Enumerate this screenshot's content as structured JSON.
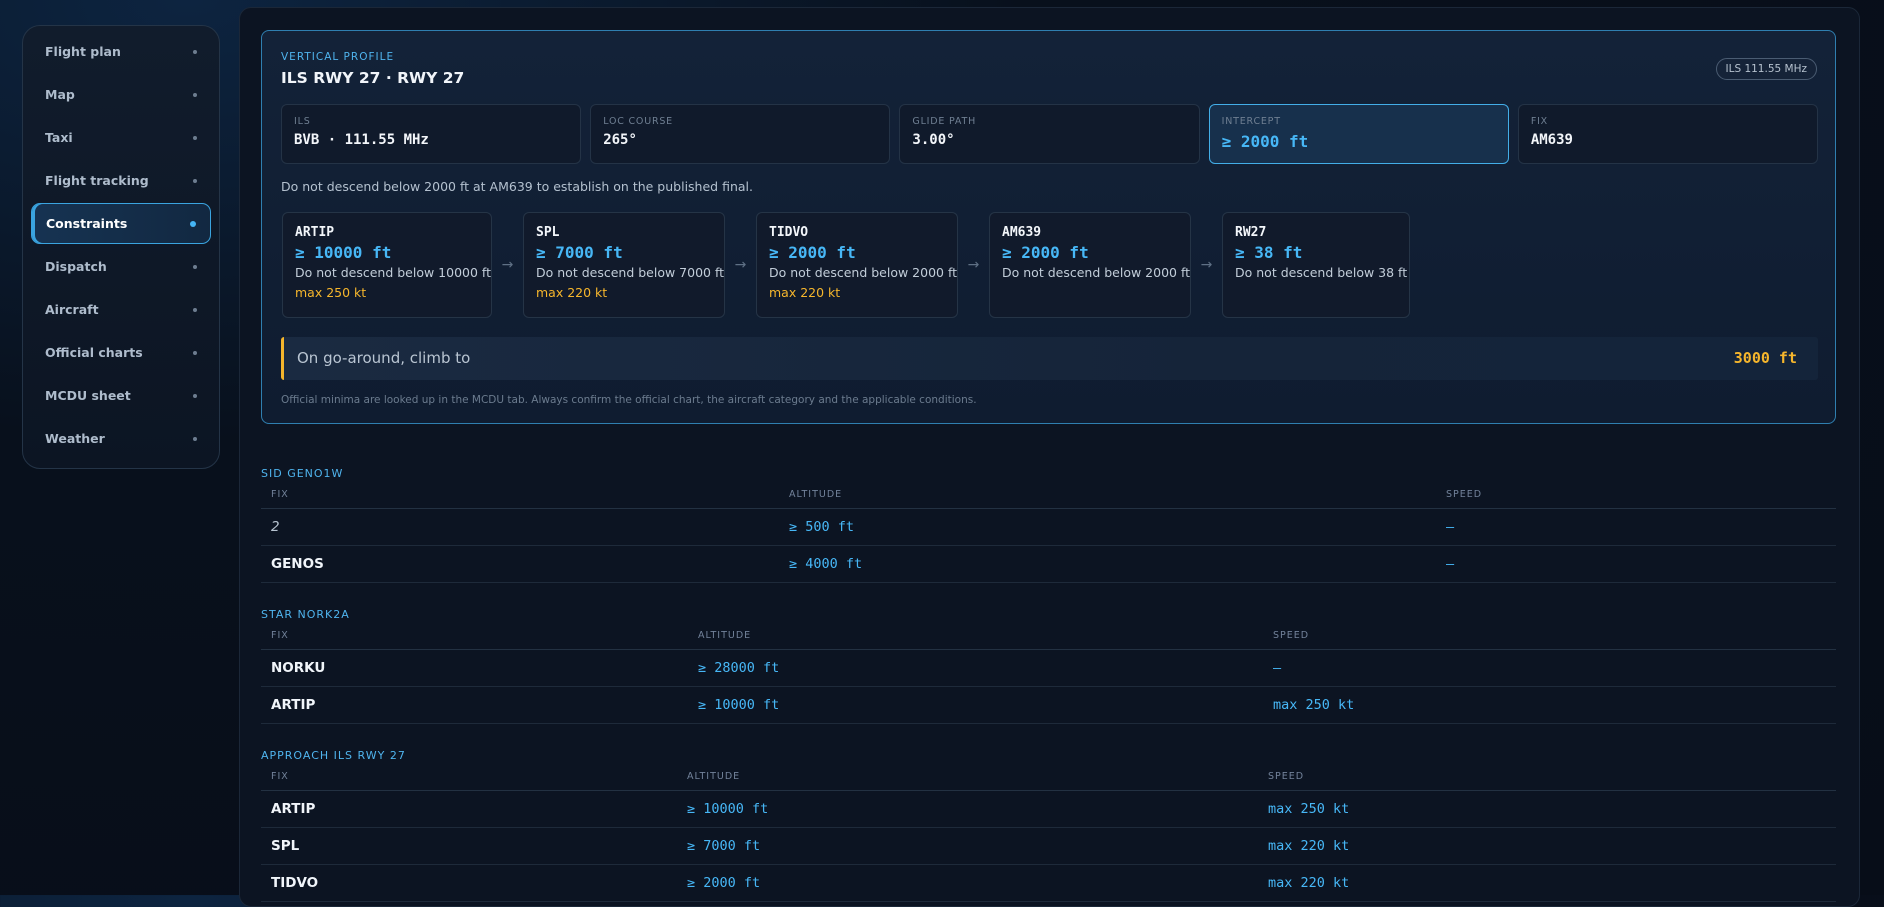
{
  "sidebar": {
    "items": [
      {
        "label": "Flight plan"
      },
      {
        "label": "Map"
      },
      {
        "label": "Taxi"
      },
      {
        "label": "Flight tracking"
      },
      {
        "label": "Constraints"
      },
      {
        "label": "Dispatch"
      },
      {
        "label": "Aircraft"
      },
      {
        "label": "Official charts"
      },
      {
        "label": "MCDU sheet"
      },
      {
        "label": "Weather"
      }
    ],
    "active": "Constraints"
  },
  "vertical_profile": {
    "kicker": "VERTICAL PROFILE",
    "title": "ILS RWY 27 · RWY 27",
    "badge": "ILS 111.55 MHz",
    "info": [
      {
        "label": "ILS",
        "value": "BVB · 111.55 MHz"
      },
      {
        "label": "LOC COURSE",
        "value": "265°"
      },
      {
        "label": "GLIDE PATH",
        "value": "3.00°"
      },
      {
        "label": "INTERCEPT",
        "value": "≥ 2000 ft"
      },
      {
        "label": "FIX",
        "value": "AM639"
      }
    ],
    "note": "Do not descend below 2000 ft at AM639 to establish on the published final.",
    "fixes": [
      {
        "name": "ARTIP",
        "alt": "≥ 10000 ft",
        "desc": "Do not descend below 10000 ft",
        "speed": "max 250 kt"
      },
      {
        "name": "SPL",
        "alt": "≥ 7000 ft",
        "desc": "Do not descend below 7000 ft",
        "speed": "max 220 kt"
      },
      {
        "name": "TIDVO",
        "alt": "≥ 2000 ft",
        "desc": "Do not descend below 2000 ft",
        "speed": "max 220 kt"
      },
      {
        "name": "AM639",
        "alt": "≥ 2000 ft",
        "desc": "Do not descend below 2000 ft",
        "speed": ""
      },
      {
        "name": "RW27",
        "alt": "≥ 38 ft",
        "desc": "Do not descend below 38 ft",
        "speed": ""
      }
    ],
    "arrow": "→",
    "go_around": {
      "label": "On go-around, climb to",
      "value": "3000 ft"
    },
    "footnote": "Official minima are looked up in the MCDU tab. Always confirm the official chart, the aircraft category and the applicable conditions."
  },
  "tables": [
    {
      "title": "SID GENO1W",
      "headers": [
        "FIX",
        "ALTITUDE",
        "SPEED"
      ],
      "rows": [
        [
          "2",
          "≥ 500 ft",
          "—"
        ],
        [
          "GENOS",
          "≥ 4000 ft",
          "—"
        ]
      ]
    },
    {
      "title": "STAR NORK2A",
      "headers": [
        "FIX",
        "ALTITUDE",
        "SPEED"
      ],
      "rows": [
        [
          "NORKU",
          "≥ 28000 ft",
          "—"
        ],
        [
          "ARTIP",
          "≥ 10000 ft",
          "max 250 kt"
        ]
      ]
    },
    {
      "title": "APPROACH ILS RWY 27",
      "headers": [
        "FIX",
        "ALTITUDE",
        "SPEED"
      ],
      "rows": [
        [
          "ARTIP",
          "≥ 10000 ft",
          "max 250 kt"
        ],
        [
          "SPL",
          "≥ 7000 ft",
          "max 220 kt"
        ],
        [
          "TIDVO",
          "≥ 2000 ft",
          "max 220 kt"
        ]
      ]
    }
  ],
  "colors": {
    "accent": "#47b7f6",
    "warning": "#f6b62c",
    "background": "#0c1422"
  }
}
